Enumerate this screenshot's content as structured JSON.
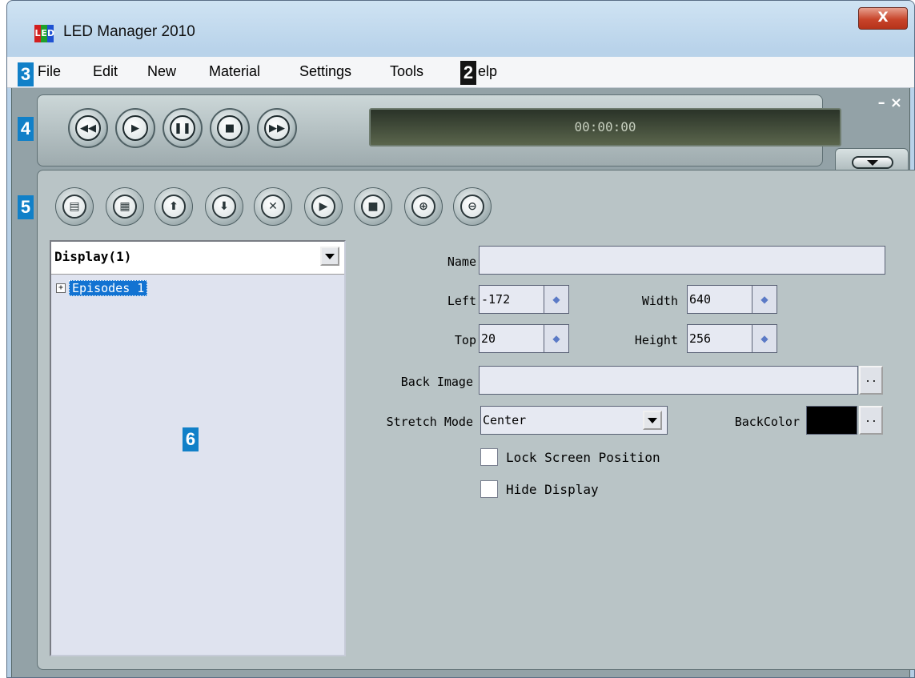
{
  "window": {
    "title": "LED Manager 2010",
    "logo_letters": [
      "L",
      "E",
      "D"
    ],
    "close_label": "X"
  },
  "menu": {
    "items": [
      "File",
      "Edit",
      "New",
      "Material",
      "Settings",
      "Tools",
      "elp"
    ]
  },
  "badges": [
    "3",
    "2",
    "4",
    "5",
    "6"
  ],
  "player": {
    "timecode": "00:00:00",
    "float_controls": "– ×",
    "buttons": [
      "rewind-icon",
      "play-icon",
      "pause-icon",
      "stop-icon",
      "fast-forward-icon"
    ]
  },
  "toolbar": {
    "buttons": [
      "new-page-icon",
      "film-icon",
      "move-up-icon",
      "move-down-icon",
      "delete-icon",
      "play-icon",
      "stop-icon",
      "zoom-in-icon",
      "zoom-out-icon"
    ]
  },
  "tree": {
    "selector": "Display(1)",
    "node_label": "Episodes 1",
    "expander": "+"
  },
  "properties": {
    "name_label": "Name",
    "name_value": "",
    "left_label": "Left",
    "left_value": "-172",
    "width_label": "Width",
    "width_value": "640",
    "top_label": "Top",
    "top_value": "20",
    "height_label": "Height",
    "height_value": "256",
    "back_image_label": "Back Image",
    "back_image_value": "",
    "browse_label": "..",
    "stretch_mode_label": "Stretch Mode",
    "stretch_mode_value": "Center",
    "back_color_label": "BackColor",
    "back_color_value": "#000000",
    "lock_label": "Lock Screen Position",
    "lock_checked": false,
    "hide_label": "Hide Display",
    "hide_checked": false
  },
  "colors": {
    "badge_blue": "#1180c8",
    "selection_blue": "#1273d2",
    "title_close_red": "#c8442a"
  }
}
